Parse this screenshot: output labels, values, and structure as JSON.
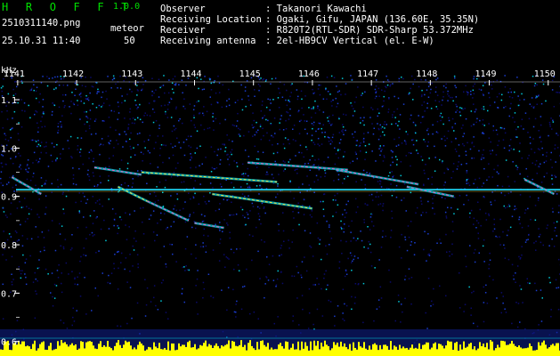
{
  "header": {
    "app_title": "H R O F F T",
    "app_version": "1.0.0",
    "filename": "2510311140.png",
    "datetime": "25.10.31 11:40",
    "counter_label": "meteor",
    "counter_value": "50",
    "info": [
      {
        "key": "Observer",
        "value": ": Takanori Kawachi"
      },
      {
        "key": "Receiving Location",
        "value": ": Ogaki, Gifu, JAPAN (136.60E, 35.35N)"
      },
      {
        "key": "Receiver",
        "value": ": R820T2(RTL-SDR) SDR-Sharp 53.372MHz"
      },
      {
        "key": "Receiving antenna",
        "value": ": 2el-HB9CV Vertical (el. E-W)"
      }
    ]
  },
  "chart_data": {
    "type": "heatmap",
    "ylabel": "kHz",
    "x_ticks": [
      "1141",
      "1142",
      "1143",
      "1144",
      "1145",
      "1146",
      "1147",
      "1148",
      "1149",
      "1150"
    ],
    "y_ticks": [
      "1.1",
      "1.0",
      "0.9",
      "0.8",
      "0.7",
      "0.6"
    ],
    "ylim": [
      0.57,
      1.17
    ],
    "xlim": [
      1140.7,
      1150.2
    ],
    "carrier_khz": 0.914,
    "echoes": [
      {
        "x": [
          1140.9,
          1141.4
        ],
        "y": [
          0.94,
          0.905
        ]
      },
      {
        "x": [
          1142.3,
          1143.1
        ],
        "y": [
          0.96,
          0.945
        ]
      },
      {
        "x": [
          1143.1,
          1145.4
        ],
        "y": [
          0.95,
          0.93
        ]
      },
      {
        "x": [
          1144.9,
          1146.6
        ],
        "y": [
          0.97,
          0.955
        ]
      },
      {
        "x": [
          1146.4,
          1147.8
        ],
        "y": [
          0.955,
          0.925
        ]
      },
      {
        "x": [
          1142.7,
          1143.2
        ],
        "y": [
          0.92,
          0.89
        ]
      },
      {
        "x": [
          1143.2,
          1143.9
        ],
        "y": [
          0.89,
          0.85
        ]
      },
      {
        "x": [
          1144.0,
          1144.5
        ],
        "y": [
          0.845,
          0.835
        ]
      },
      {
        "x": [
          1144.3,
          1146.0
        ],
        "y": [
          0.905,
          0.875
        ]
      },
      {
        "x": [
          1147.6,
          1148.4
        ],
        "y": [
          0.92,
          0.9
        ]
      },
      {
        "x": [
          1149.6,
          1150.1
        ],
        "y": [
          0.935,
          0.905
        ]
      }
    ]
  },
  "colors": {
    "background": "#000000",
    "noise_dark": "#0a0a6a",
    "noise_mid": "#1a3ccf",
    "noise_cyan": "#00c8d8",
    "carrier": "#20e0ff",
    "echo_hot": "#ff60c0",
    "echo_warm": "#ffe040",
    "floor": "#ffff00",
    "grid": "#ffffff",
    "accent_green": "#00e000"
  }
}
